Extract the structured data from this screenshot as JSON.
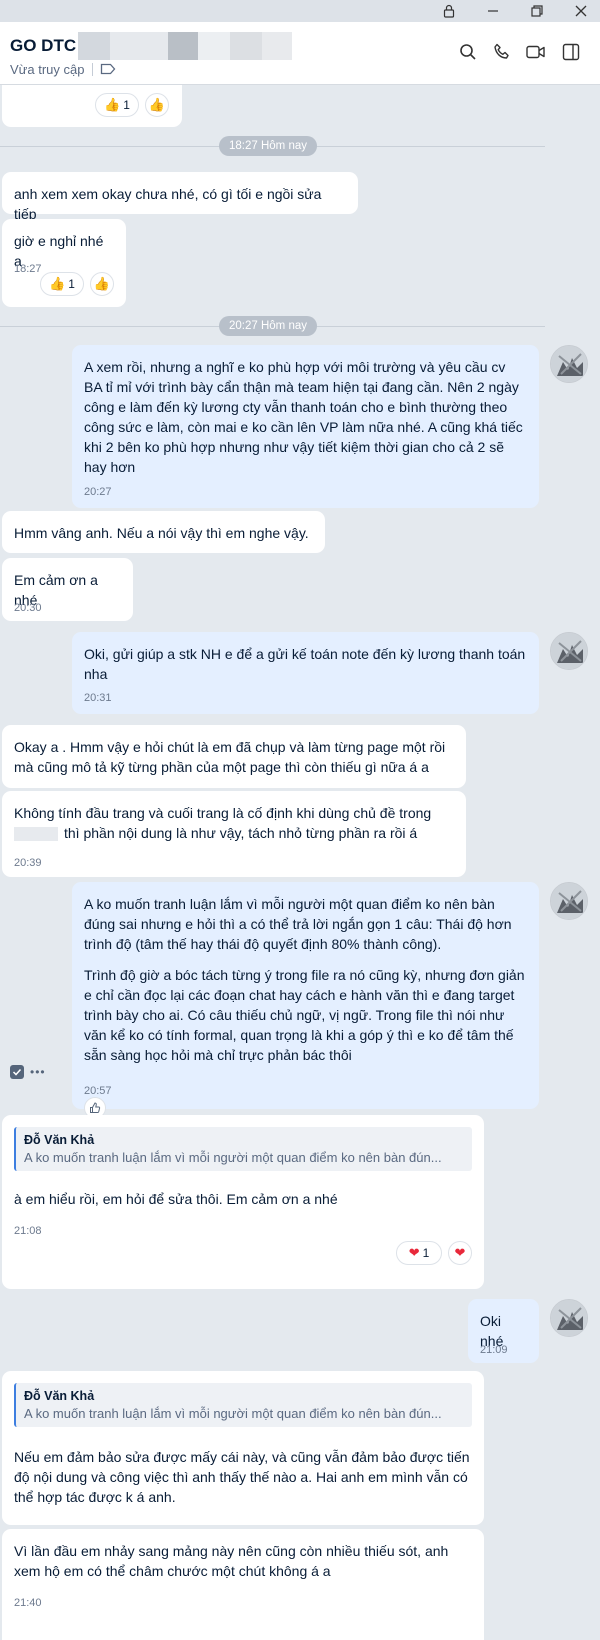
{
  "header": {
    "title": "GO DTC",
    "status": "Vừa truy cập"
  },
  "dividers": [
    "18:27 Hôm nay",
    "20:27 Hôm nay"
  ],
  "messages": [
    {
      "text": "anh xem xem okay chưa nhé, có gì tối e ngồi sửa tiếp"
    },
    {
      "text": "giờ e nghỉ nhé a",
      "time": "18:27"
    },
    {
      "text": "A xem rồi, nhưng a nghĩ e ko phù hợp với môi trường và yêu cầu cv BA tỉ mỉ với trình bày cẩn thận mà team hiện tại đang cần. Nên 2 ngày công e làm đến kỳ lương cty vẫn thanh toán cho e bình thường theo công sức e làm, còn mai e ko cần lên VP làm nữa nhé. A cũng khá tiếc khi 2 bên ko phù hợp nhưng như vậy tiết kiệm thời gian cho cả 2 sẽ hay hơn",
      "time": "20:27"
    },
    {
      "text": "Hmm vâng anh. Nếu a nói vậy thì em nghe vậy."
    },
    {
      "text": "Em cảm ơn a nhé",
      "time": "20:30"
    },
    {
      "text": "Oki, gửi giúp a stk NH e để a gửi kế toán note đến kỳ lương thanh toán nha",
      "time": "20:31"
    },
    {
      "text": "Okay a . Hmm vậy e hỏi chút là em đã chụp và làm từng page một rồi mà cũng mô tả kỹ từng phần của một page thì còn thiếu gì nữa á a"
    },
    {
      "text": "Không tính đầu trang và cuối trang là cố định khi dùng chủ đề trong",
      "text2": "thì phần nội dung là như vậy, tách nhỏ từng phần ra rồi á",
      "time": "20:39"
    },
    {
      "text": "A ko muốn tranh luận lắm vì mỗi người một quan điểm ko nên bàn đúng sai nhưng e hỏi thì a có thể trả lời ngắn gọn 1 câu: Thái độ hơn trình độ (tâm thế hay thái độ quyết định 80% thành công).",
      "text2": "Trình độ giờ a bóc tách từng ý trong file ra nó cũng kỳ, nhưng đơn giản e chỉ cần đọc lại các đoạn chat hay cách e hành văn thì e đang target trình bày cho ai. Có câu thiếu chủ ngữ, vị ngữ. Trong file thì nói như văn kể ko có tính formal, quan trọng là khi a góp ý thì e ko để tâm thế sẵn sàng học hỏi mà chỉ trực phản bác thôi",
      "time": "20:57"
    },
    {
      "quote_name": "Đỗ Văn Khả",
      "quote_text": "A ko muốn tranh luận lắm vì mỗi người một quan điểm ko nên bàn đún...",
      "text": "à em hiểu rồi, em hỏi để sửa thôi. Em cảm ơn a nhé",
      "time": "21:08"
    },
    {
      "text": "Oki nhé",
      "time": "21:09"
    },
    {
      "quote_name": "Đỗ Văn Khả",
      "quote_text": "A ko muốn tranh luận lắm vì mỗi người một quan điểm ko nên bàn đún...",
      "text": "Nếu em đảm bảo sửa được mấy cái này, và cũng vẫn đảm bảo được tiến độ nội dung và công việc thì anh thấy thế nào a. Hai anh em mình vẫn có thể hợp tác được k á anh."
    },
    {
      "text": "Vì lần đầu em nhảy sang mảng này nên cũng còn nhiều thiếu sót, anh xem hộ em có thể châm chước một chút không á a",
      "time": "21:40"
    }
  ],
  "reactions": {
    "like_count": "1",
    "heart_count": "1"
  },
  "more_label": "•••",
  "icons": [
    "lock-icon",
    "restore-icon",
    "close-icon",
    "tag-icon",
    "search-icon",
    "phone-icon",
    "video-icon",
    "sidebar-icon",
    "thumbs-up-icon",
    "heart-icon",
    "check-icon"
  ],
  "colors": {
    "incoming": "#ffffff",
    "outgoing": "#e4efff",
    "background": "#e4e9ee",
    "quote_bar": "#3d7ee0",
    "heart": "#e8283a",
    "like": "#f5b731"
  }
}
